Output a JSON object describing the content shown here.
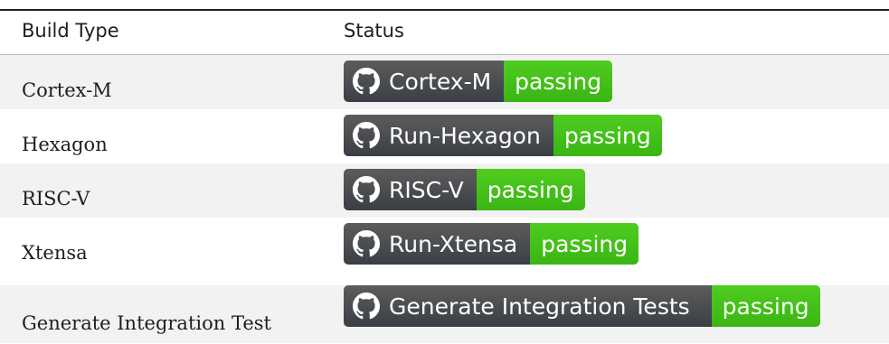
{
  "table": {
    "headers": {
      "build_type": "Build Type",
      "status": "Status"
    },
    "rows": [
      {
        "build_type": "Cortex-M",
        "badge_label": "Cortex-M",
        "badge_status": "passing"
      },
      {
        "build_type": "Hexagon",
        "badge_label": "Run-Hexagon",
        "badge_status": "passing"
      },
      {
        "build_type": "RISC-V",
        "badge_label": "RISC-V",
        "badge_status": "passing"
      },
      {
        "build_type": "Xtensa",
        "badge_label": "Run-Xtensa",
        "badge_status": "passing"
      },
      {
        "build_type": "Generate Integration Test",
        "badge_label": "Generate Integration Tests",
        "badge_status": "passing"
      }
    ]
  },
  "icons": {
    "badge_icon": "github-icon"
  },
  "colors": {
    "badge_label_bg": "#3a3f45",
    "badge_status_bg": "#44bb19",
    "stripe_bg": "#f2f2f2"
  }
}
